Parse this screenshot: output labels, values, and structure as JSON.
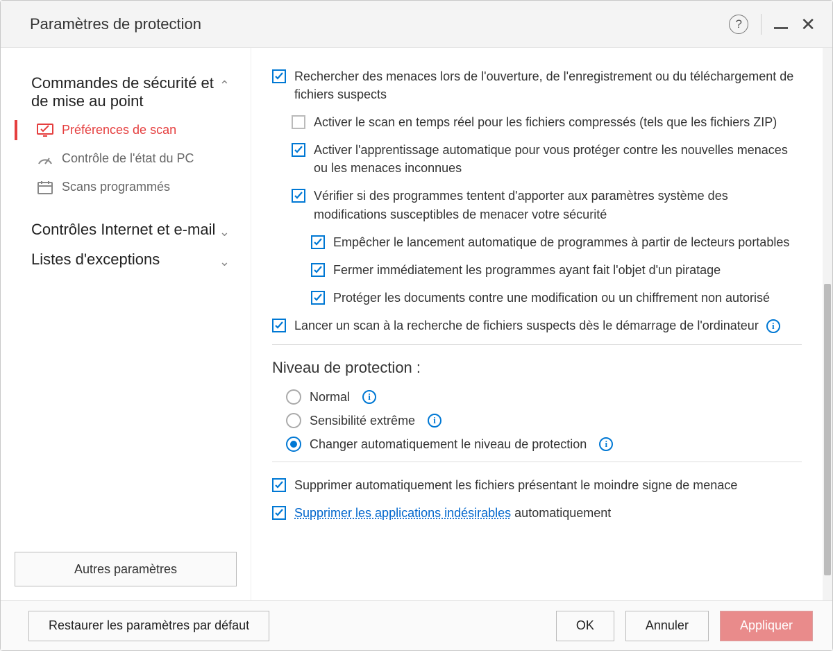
{
  "window": {
    "title": "Paramètres de protection"
  },
  "sidebar": {
    "sections": [
      {
        "label": "Commandes de sécurité et de mise au point",
        "expanded": true
      },
      {
        "label": "Contrôles Internet et e-mail",
        "expanded": false
      },
      {
        "label": "Listes d'exceptions",
        "expanded": false
      }
    ],
    "items": [
      {
        "label": "Préférences de scan"
      },
      {
        "label": "Contrôle de l'état du PC"
      },
      {
        "label": "Scans programmés"
      }
    ],
    "other_settings": "Autres paramètres"
  },
  "options": {
    "scan_on_open": "Rechercher des menaces lors de l'ouverture, de l'enregistrement ou du téléchargement de fichiers suspects",
    "realtime_compressed": "Activer le scan en temps réel pour les fichiers compressés (tels que les fichiers ZIP)",
    "ml_protect": "Activer l'apprentissage automatique pour vous protéger contre les nouvelles menaces ou les menaces inconnues",
    "monitor_system_changes": "Vérifier si des programmes tentent d'apporter aux paramètres système des modifications susceptibles de menacer votre sécurité",
    "block_portable_autorun": "Empêcher le lancement automatique de programmes à partir de lecteurs portables",
    "close_hijacked": "Fermer immédiatement les programmes ayant fait l'objet d'un piratage",
    "protect_docs": "Protéger les documents contre une modification ou un chiffrement non autorisé",
    "scan_on_boot": "Lancer un scan à la recherche de fichiers suspects dès le démarrage de l'ordinateur",
    "auto_delete": "Supprimer automatiquement les fichiers présentant le moindre signe de menace",
    "remove_pua_link": "Supprimer les applications indésirables",
    "remove_pua_tail": " automatiquement"
  },
  "protection_level": {
    "title": "Niveau de protection :",
    "normal": "Normal",
    "extreme": "Sensibilité extrême",
    "auto": "Changer automatiquement le niveau de protection"
  },
  "footer": {
    "restore": "Restaurer les paramètres par défaut",
    "ok": "OK",
    "cancel": "Annuler",
    "apply": "Appliquer"
  }
}
